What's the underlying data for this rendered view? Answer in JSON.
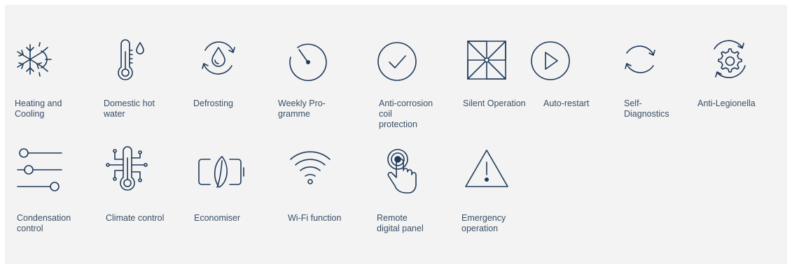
{
  "colors": {
    "panel_background": "#f3f3f3",
    "icon_stroke": "#1f3a5a",
    "label_text": "#3a4f66"
  },
  "features": [
    {
      "icon": "snowflake-sun-icon",
      "label": "Heating and\nCooling"
    },
    {
      "icon": "thermometer-drop-icon",
      "label": "Domestic hot\nwater"
    },
    {
      "icon": "drop-cycle-icon",
      "label": "Defrosting"
    },
    {
      "icon": "timer-icon",
      "label": "Weekly Pro-\ngramme"
    },
    {
      "icon": "checkmark-circle-icon",
      "label": "Anti-corrosion\ncoil\nprotection"
    },
    {
      "icon": "pinwheel-icon",
      "label": "Silent Operation"
    },
    {
      "icon": "play-circle-icon",
      "label": "Auto-restart"
    },
    {
      "icon": "refresh-cycle-icon",
      "label": "Self-\nDiagnostics"
    },
    {
      "icon": "gear-cycle-icon",
      "label": "Anti-Legionella"
    },
    {
      "icon": "sliders-icon",
      "label": "Condensation\ncontrol"
    },
    {
      "icon": "circuit-thermometer-icon",
      "label": "Climate control"
    },
    {
      "icon": "leaf-battery-icon",
      "label": "Economiser"
    },
    {
      "icon": "wifi-icon",
      "label": "Wi-Fi function"
    },
    {
      "icon": "touch-button-icon",
      "label": "Remote\ndigital panel"
    },
    {
      "icon": "warning-triangle-icon",
      "label": "Emergency\noperation"
    }
  ]
}
